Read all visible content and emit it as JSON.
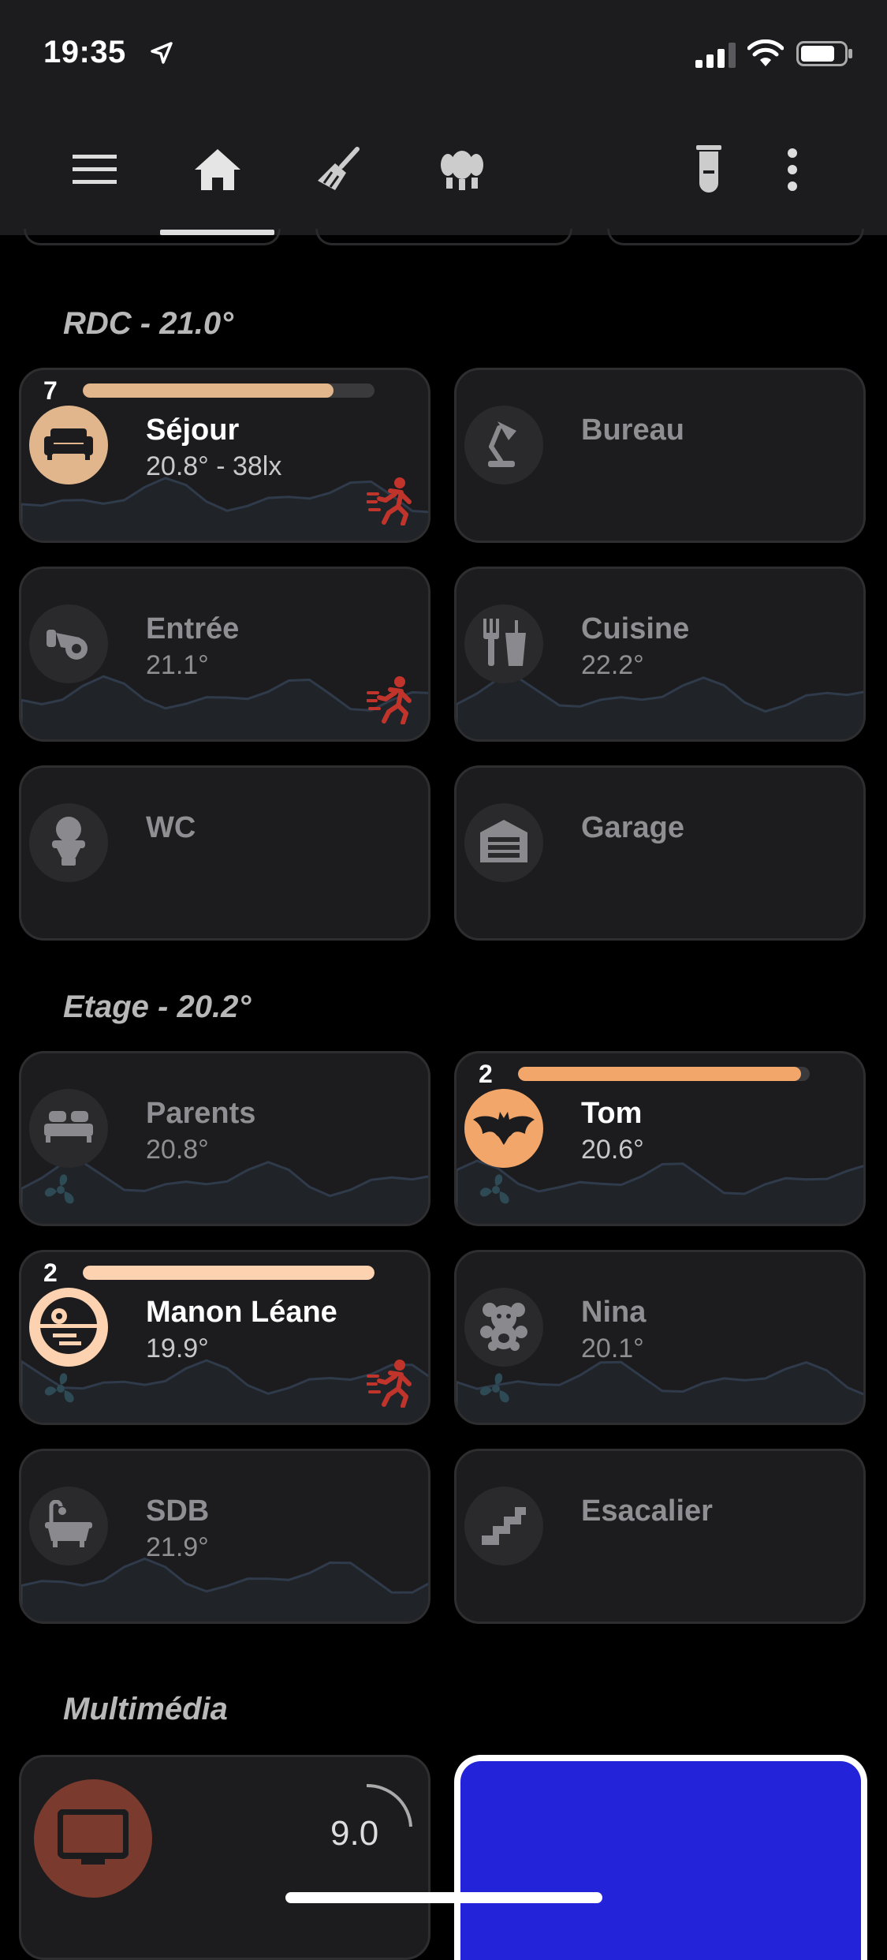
{
  "status": {
    "time": "19:35"
  },
  "colors": {
    "background": "#000000",
    "card": "#1c1c1e",
    "accent_sand": "#e2b68d",
    "accent_orange": "#f2a66a",
    "accent_peach": "#fcd2b0",
    "motion_red": "#c0342c",
    "tv_brown": "#7a3b2e",
    "media_blue": "#2323d9"
  },
  "nav": {
    "icons": [
      "menu-icon",
      "home-icon",
      "broom-icon",
      "lighting-icon",
      "test-tube-icon",
      "more-vert-icon"
    ],
    "active": "home-icon"
  },
  "sections": [
    {
      "title": "RDC - 21.0°",
      "rooms": [
        {
          "name": "Séjour",
          "sub": "20.8° - 38lx",
          "icon": "sofa-icon",
          "active": true,
          "count": "7",
          "level": 0.86,
          "bar_color": "#e2b68d",
          "motion": true,
          "fan": false
        },
        {
          "name": "Bureau",
          "sub": "",
          "icon": "desk-lamp-icon",
          "active": false,
          "motion": false,
          "fan": false
        },
        {
          "name": "Entrée",
          "sub": "21.1°",
          "icon": "coat-hanger-icon",
          "active": false,
          "motion": true,
          "fan": false
        },
        {
          "name": "Cuisine",
          "sub": "22.2°",
          "icon": "food-drink-icon",
          "active": false,
          "motion": false,
          "fan": false
        },
        {
          "name": "WC",
          "sub": "",
          "icon": "toilet-icon",
          "active": false,
          "motion": false,
          "fan": false
        },
        {
          "name": "Garage",
          "sub": "",
          "icon": "garage-icon",
          "active": false,
          "motion": false,
          "fan": false
        }
      ]
    },
    {
      "title": "Etage - 20.2°",
      "rooms": [
        {
          "name": "Parents",
          "sub": "20.8°",
          "icon": "bed-icon",
          "active": false,
          "motion": false,
          "fan": true
        },
        {
          "name": "Tom",
          "sub": "20.6°",
          "icon": "bat-icon",
          "active": true,
          "count": "2",
          "level": 0.97,
          "bar_color": "#f2a66a",
          "motion": false,
          "fan": true
        },
        {
          "name": "Manon Léane",
          "sub": "19.9°",
          "icon": "death-star-icon",
          "active": true,
          "count": "2",
          "level": 1.0,
          "bar_color": "#fcd2b0",
          "motion": true,
          "fan": true
        },
        {
          "name": "Nina",
          "sub": "20.1°",
          "icon": "teddy-bear-icon",
          "active": false,
          "motion": false,
          "fan": true
        },
        {
          "name": "SDB",
          "sub": "21.9°",
          "icon": "bathtub-icon",
          "active": false,
          "motion": false,
          "fan": false
        },
        {
          "name": "Esacalier",
          "sub": "",
          "icon": "stairs-icon",
          "active": false,
          "motion": false,
          "fan": false
        }
      ]
    },
    {
      "title": "Multimédia",
      "rooms": []
    }
  ],
  "multimedia": {
    "value": "9.0",
    "icon": "tv-icon"
  }
}
